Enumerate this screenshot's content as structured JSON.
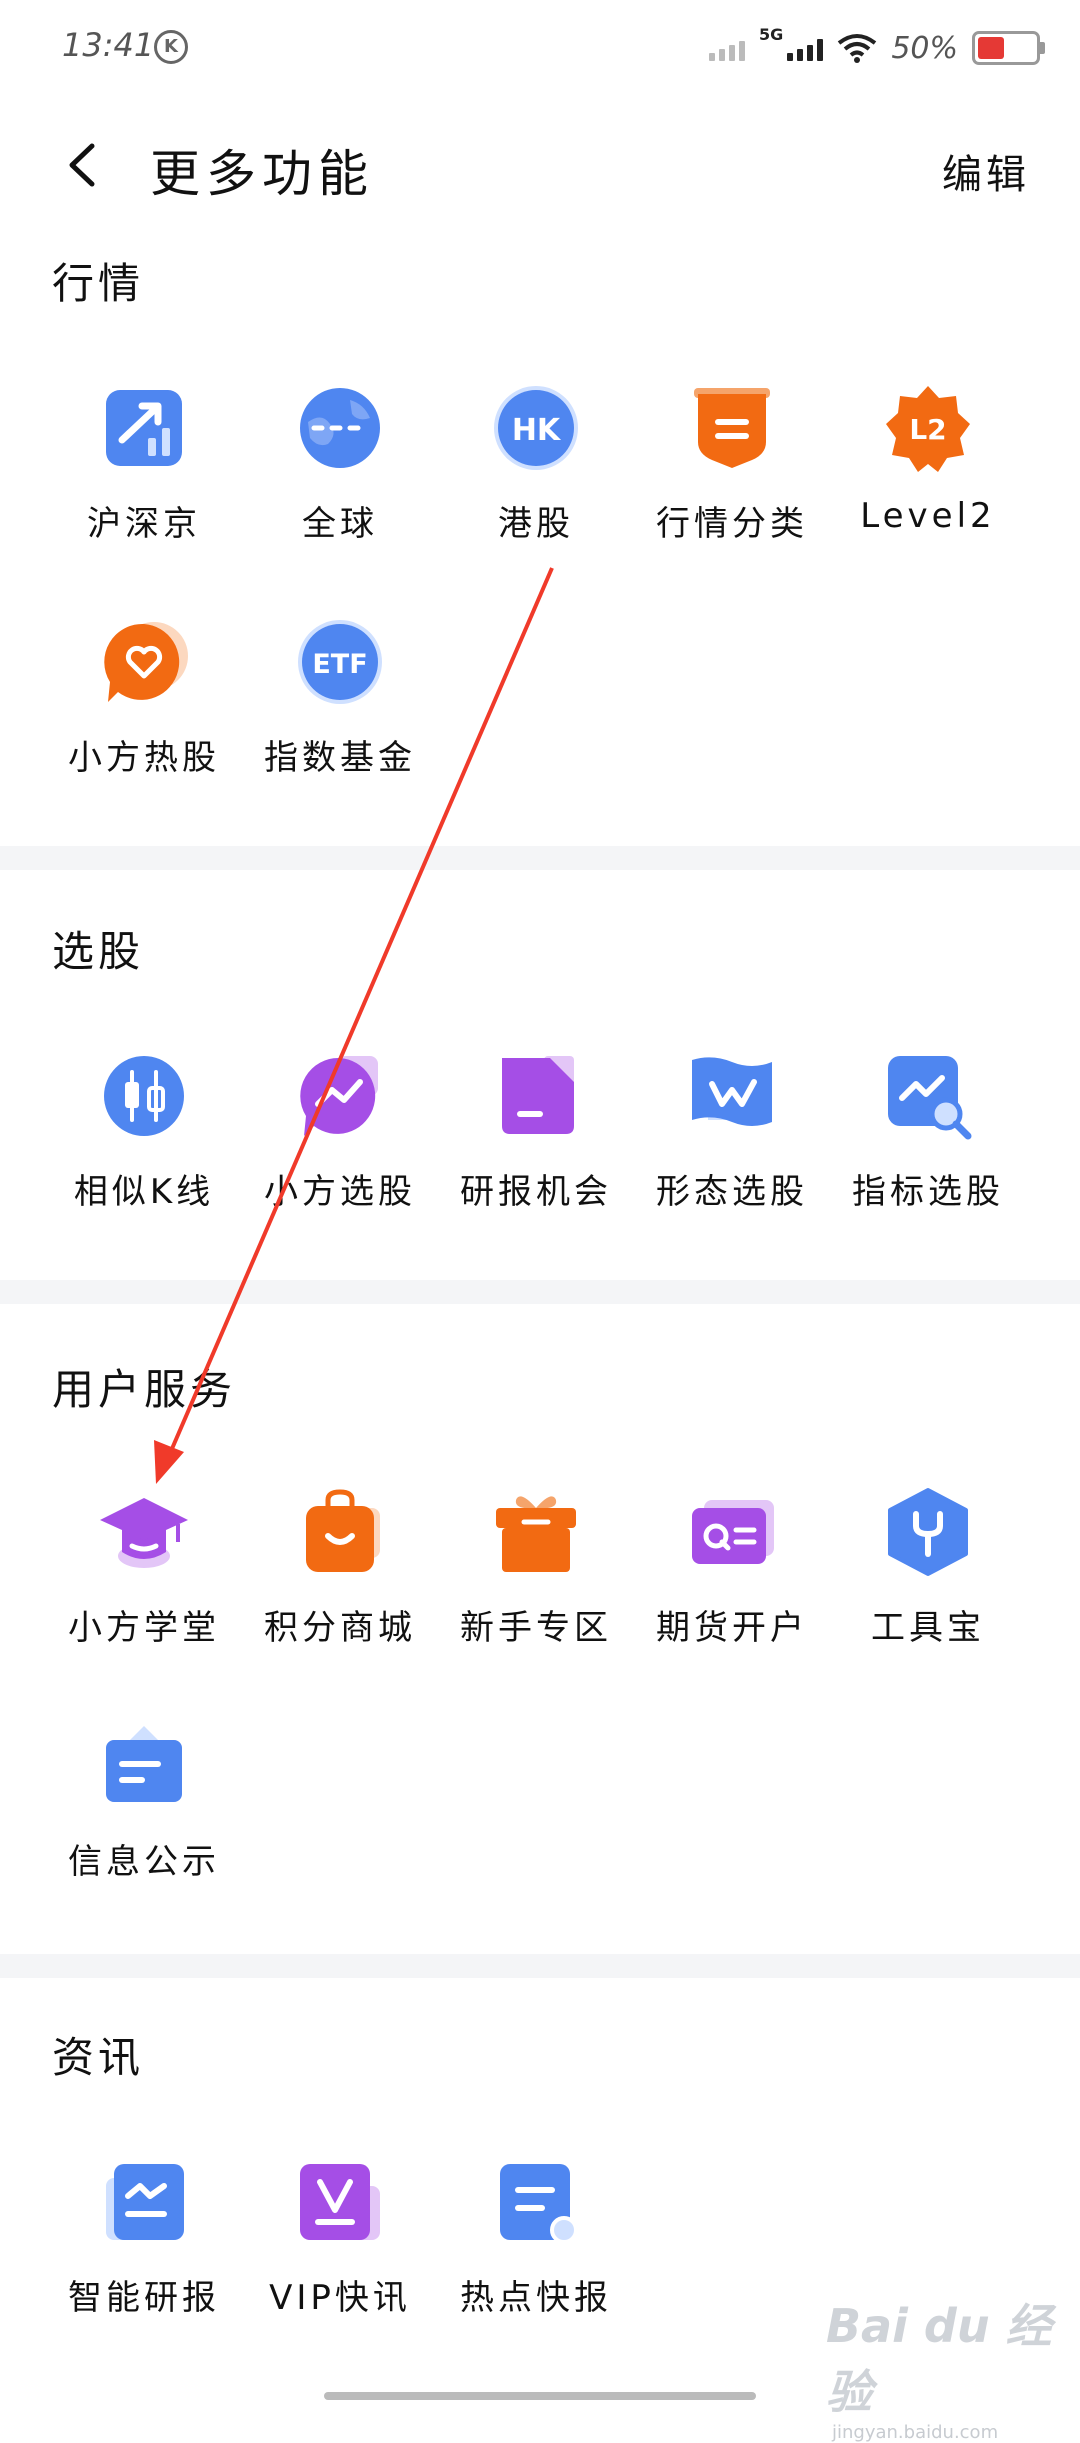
{
  "status": {
    "time": "13:41",
    "battery": "50%",
    "network": "5G"
  },
  "header": {
    "title": "更多功能",
    "edit": "编辑"
  },
  "sections": {
    "market": {
      "title": "行情",
      "items": [
        {
          "label": "沪深京",
          "icon": "chart-up-icon"
        },
        {
          "label": "全球",
          "icon": "globe-icon"
        },
        {
          "label": "港股",
          "icon": "hk-icon"
        },
        {
          "label": "行情分类",
          "icon": "category-shield-icon"
        },
        {
          "label": "Level2",
          "icon": "l2-badge-icon"
        },
        {
          "label": "小方热股",
          "icon": "heart-bubble-icon"
        },
        {
          "label": "指数基金",
          "icon": "etf-icon"
        }
      ]
    },
    "stock": {
      "title": "选股",
      "items": [
        {
          "label": "相似K线",
          "icon": "candlestick-icon"
        },
        {
          "label": "小方选股",
          "icon": "chat-trend-icon"
        },
        {
          "label": "研报机会",
          "icon": "report-doc-icon"
        },
        {
          "label": "形态选股",
          "icon": "pattern-flag-icon"
        },
        {
          "label": "指标选股",
          "icon": "indicator-search-icon"
        }
      ]
    },
    "service": {
      "title": "用户服务",
      "items": [
        {
          "label": "小方学堂",
          "icon": "graduation-cap-icon"
        },
        {
          "label": "积分商城",
          "icon": "shopping-bag-icon"
        },
        {
          "label": "新手专区",
          "icon": "gift-box-icon"
        },
        {
          "label": "期货开户",
          "icon": "id-card-icon"
        },
        {
          "label": "工具宝",
          "icon": "tool-hexagon-icon"
        },
        {
          "label": "信息公示",
          "icon": "notice-board-icon"
        }
      ]
    },
    "news": {
      "title": "资讯",
      "items": [
        {
          "label": "智能研报",
          "icon": "smart-report-icon"
        },
        {
          "label": "VIP快讯",
          "icon": "vip-flash-icon"
        },
        {
          "label": "热点快报",
          "icon": "hot-news-icon"
        }
      ]
    }
  },
  "watermark": {
    "brand": "Bai du 经验",
    "url": "jingyan.baidu.com"
  },
  "colors": {
    "blue": "#4f86f0",
    "orange": "#f26a12",
    "purple": "#a54ee6"
  }
}
